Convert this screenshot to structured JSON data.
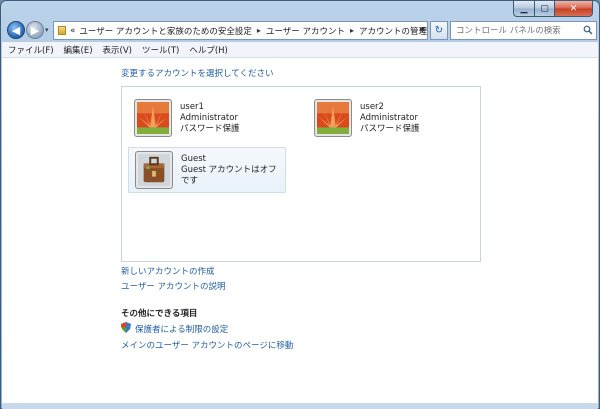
{
  "nav": {
    "history_prefix": "«",
    "breadcrumbs": [
      "ユーザー アカウントと家族のための安全設定",
      "ユーザー アカウント",
      "アカウントの管理"
    ],
    "search_placeholder": "コントロール パネルの検索"
  },
  "menu": [
    "ファイル(F)",
    "編集(E)",
    "表示(V)",
    "ツール(T)",
    "ヘルプ(H)"
  ],
  "content": {
    "heading": "変更するアカウントを選択してください",
    "accounts": [
      {
        "name": "user1",
        "role": "Administrator",
        "status": "パスワード保護"
      },
      {
        "name": "user2",
        "role": "Administrator",
        "status": "パスワード保護"
      },
      {
        "name": "Guest",
        "status": "Guest アカウントはオフです"
      }
    ],
    "links": {
      "create": "新しいアカウントの作成",
      "about": "ユーザー アカウントの説明"
    },
    "other_title": "その他にできる項目",
    "other_links": {
      "parental": "保護者による制限の設定",
      "main_page": "メインのユーザー アカウントのページに移動"
    }
  },
  "colors": {
    "link": "#1e5fa3",
    "frame": "#9fbcd9",
    "close": "#c23f24"
  },
  "icons": {
    "back": "back-arrow-icon",
    "forward": "forward-arrow-icon",
    "refresh": "refresh-icon",
    "search": "search-icon",
    "shield": "shield-icon",
    "user_picture": "flower-picture-icon",
    "guest_picture": "suitcase-picture-icon"
  }
}
